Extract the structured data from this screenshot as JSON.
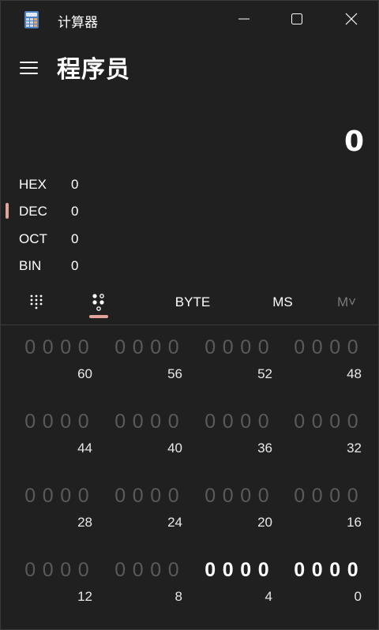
{
  "app": {
    "title": "计算器"
  },
  "header": {
    "mode_title": "程序员"
  },
  "display": {
    "value": "0"
  },
  "radix": [
    {
      "label": "HEX",
      "value": "0",
      "selected": false
    },
    {
      "label": "DEC",
      "value": "0",
      "selected": true
    },
    {
      "label": "OCT",
      "value": "0",
      "selected": false
    },
    {
      "label": "BIN",
      "value": "0",
      "selected": false
    }
  ],
  "toolbar": {
    "keypad_icon": "keypad-icon",
    "bits_icon": "bit-toggle-icon",
    "word_size": "BYTE",
    "memory_store": "MS",
    "memory_menu": "M˅"
  },
  "bit_groups": [
    {
      "bits": [
        "0",
        "0",
        "0",
        "0"
      ],
      "position": "60",
      "active": false
    },
    {
      "bits": [
        "0",
        "0",
        "0",
        "0"
      ],
      "position": "56",
      "active": false
    },
    {
      "bits": [
        "0",
        "0",
        "0",
        "0"
      ],
      "position": "52",
      "active": false
    },
    {
      "bits": [
        "0",
        "0",
        "0",
        "0"
      ],
      "position": "48",
      "active": false
    },
    {
      "bits": [
        "0",
        "0",
        "0",
        "0"
      ],
      "position": "44",
      "active": false
    },
    {
      "bits": [
        "0",
        "0",
        "0",
        "0"
      ],
      "position": "40",
      "active": false
    },
    {
      "bits": [
        "0",
        "0",
        "0",
        "0"
      ],
      "position": "36",
      "active": false
    },
    {
      "bits": [
        "0",
        "0",
        "0",
        "0"
      ],
      "position": "32",
      "active": false
    },
    {
      "bits": [
        "0",
        "0",
        "0",
        "0"
      ],
      "position": "28",
      "active": false
    },
    {
      "bits": [
        "0",
        "0",
        "0",
        "0"
      ],
      "position": "24",
      "active": false
    },
    {
      "bits": [
        "0",
        "0",
        "0",
        "0"
      ],
      "position": "20",
      "active": false
    },
    {
      "bits": [
        "0",
        "0",
        "0",
        "0"
      ],
      "position": "16",
      "active": false
    },
    {
      "bits": [
        "0",
        "0",
        "0",
        "0"
      ],
      "position": "12",
      "active": false
    },
    {
      "bits": [
        "0",
        "0",
        "0",
        "0"
      ],
      "position": "8",
      "active": false
    },
    {
      "bits": [
        "0",
        "0",
        "0",
        "0"
      ],
      "position": "4",
      "active": true
    },
    {
      "bits": [
        "0",
        "0",
        "0",
        "0"
      ],
      "position": "0",
      "active": true
    }
  ],
  "colors": {
    "accent": "#e1a39a",
    "background": "#202020",
    "inactive_bit": "#5a5a5a"
  }
}
